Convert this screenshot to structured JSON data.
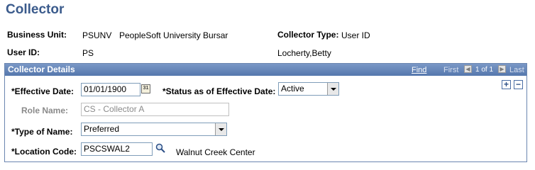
{
  "page": {
    "title": "Collector"
  },
  "header": {
    "business_unit_label": "Business Unit:",
    "business_unit_code": "PSUNV",
    "business_unit_desc": "PeopleSoft University Bursar",
    "collector_type_label": "Collector Type:",
    "collector_type_value": "User ID",
    "user_id_label": "User ID:",
    "user_id_value": "PS",
    "user_name": "Locherty,Betty"
  },
  "section": {
    "title": "Collector Details",
    "find_label": "Find",
    "first_label": "First",
    "count_label": "1 of 1",
    "last_label": "Last"
  },
  "form": {
    "effective_date_label": "*Effective Date:",
    "effective_date_value": "01/01/1900",
    "status_label": "*Status as of Effective Date:",
    "status_value": "Active",
    "role_name_label": "Role Name:",
    "role_name_value": "CS - Collector A",
    "type_of_name_label": "*Type of Name:",
    "type_of_name_value": "Preferred",
    "location_code_label": "*Location Code:",
    "location_code_value": "PSCSWAL2",
    "location_desc": "Walnut Creek Center"
  },
  "icons": {
    "calendar": "calendar-icon",
    "lookup": "magnifier-icon",
    "add_row": "plus-icon",
    "delete_row": "minus-icon",
    "prev": "left-arrow-icon",
    "next": "right-arrow-icon"
  },
  "colors": {
    "title": "#3b5b8c",
    "section_header": "#5577ad",
    "field_border": "#7f9db9"
  }
}
